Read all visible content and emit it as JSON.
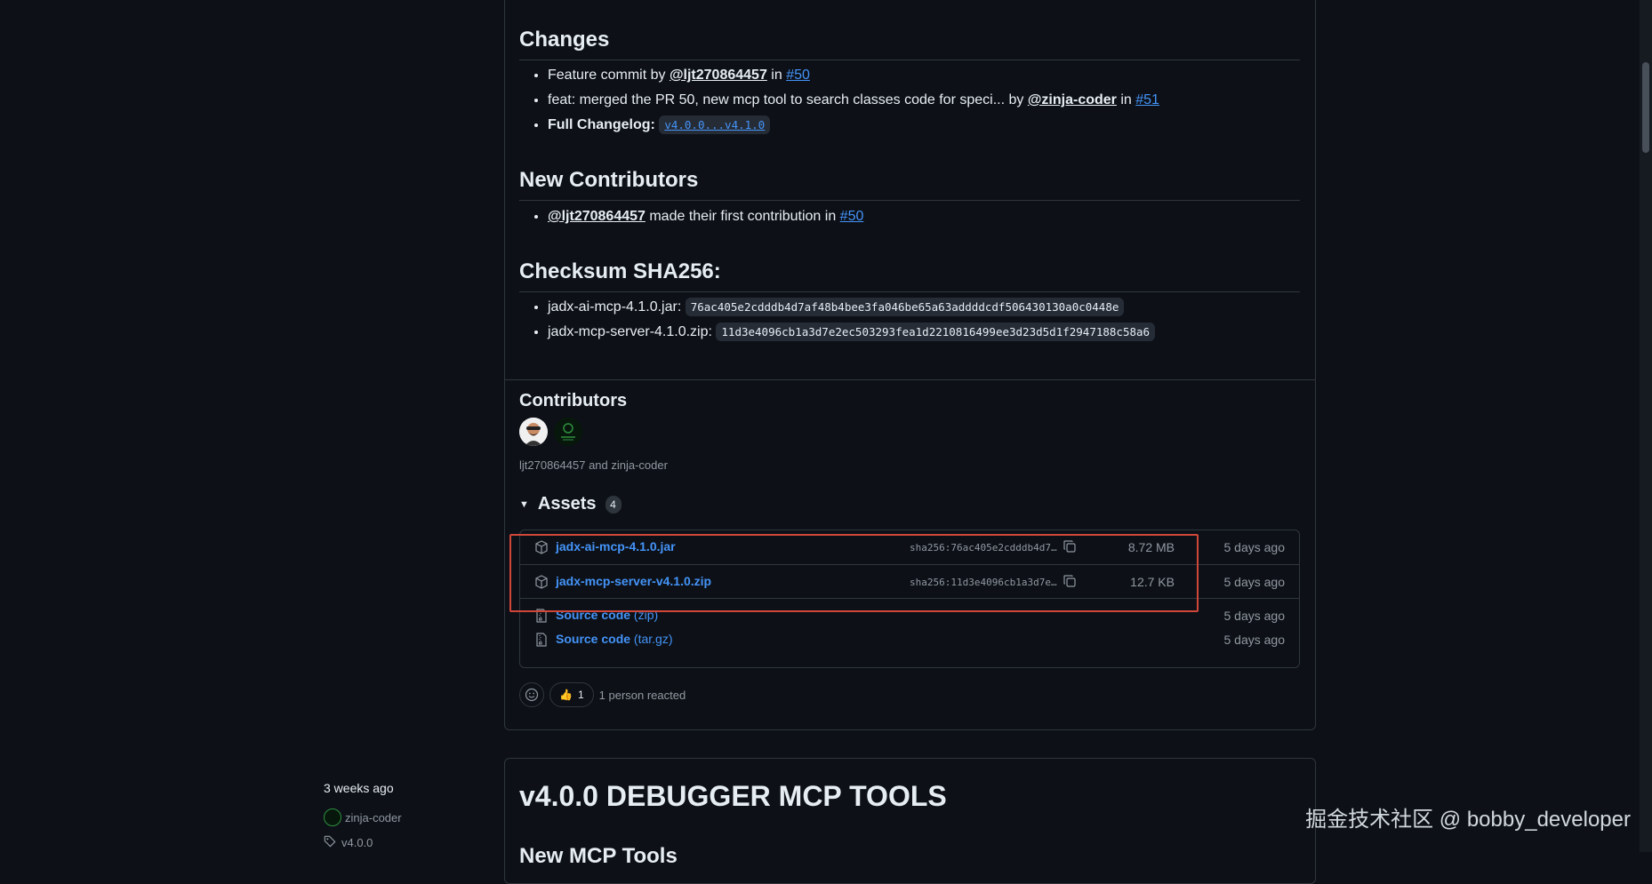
{
  "changes": {
    "heading": "Changes",
    "items": [
      {
        "prefix": "Feature commit by ",
        "mention": "@ljt270864457",
        "mid": " in ",
        "issue": "#50"
      },
      {
        "prefix": "feat: merged the PR 50, new mcp tool to search classes code for speci... by ",
        "mention": "@zinja-coder",
        "mid": " in ",
        "issue": "#51"
      }
    ],
    "full_changelog_label": "Full Changelog:",
    "full_changelog_link": "v4.0.0...v4.1.0"
  },
  "new_contributors": {
    "heading": "New Contributors",
    "mention": "@ljt270864457",
    "text": " made their first contribution in ",
    "issue": "#50"
  },
  "checksum": {
    "heading": "Checksum SHA256:",
    "items": [
      {
        "file": "jadx-ai-mcp-4.1.0.jar:",
        "hash": "76ac405e2cdddb4d7af48b4bee3fa046be65a63addddcdf506430130a0c0448e"
      },
      {
        "file": "jadx-mcp-server-4.1.0.zip:",
        "hash": "11d3e4096cb1a3d7e2ec503293fea1d2210816499ee3d23d5d1f2947188c58a6"
      }
    ]
  },
  "contributors": {
    "heading": "Contributors",
    "names": "ljt270864457 and zinja-coder"
  },
  "assets": {
    "heading": "Assets",
    "count": "4",
    "items": [
      {
        "name": "jadx-ai-mcp-4.1.0.jar",
        "sha": "sha256:76ac405e2cdddb4d7…",
        "size": "8.72 MB",
        "date": "5 days ago"
      },
      {
        "name": "jadx-mcp-server-v4.1.0.zip",
        "sha": "sha256:11d3e4096cb1a3d7e…",
        "size": "12.7 KB",
        "date": "5 days ago"
      },
      {
        "name": "Source code",
        "sub": "(zip)",
        "date": "5 days ago"
      },
      {
        "name": "Source code",
        "sub": "(tar.gz)",
        "date": "5 days ago"
      }
    ]
  },
  "reactions": {
    "thumbs_emoji": "👍",
    "thumbs_count": "1",
    "summary": "1 person reacted"
  },
  "next_release": {
    "title": "v4.0.0 DEBUGGER MCP TOOLS",
    "partial_heading": "New MCP Tools",
    "time": "3 weeks ago",
    "author": "zinja-coder",
    "tag": "v4.0.0"
  },
  "watermark": "掘金技术社区 @ bobby_developer",
  "colors": {
    "link": "#4493f8",
    "highlight_box": "#d0473a",
    "background": "#0d1117",
    "border": "#30363d"
  },
  "icons": [
    "package-icon",
    "file-zip-icon",
    "copy-icon",
    "smiley-icon",
    "tag-icon",
    "triangle-down-icon"
  ]
}
